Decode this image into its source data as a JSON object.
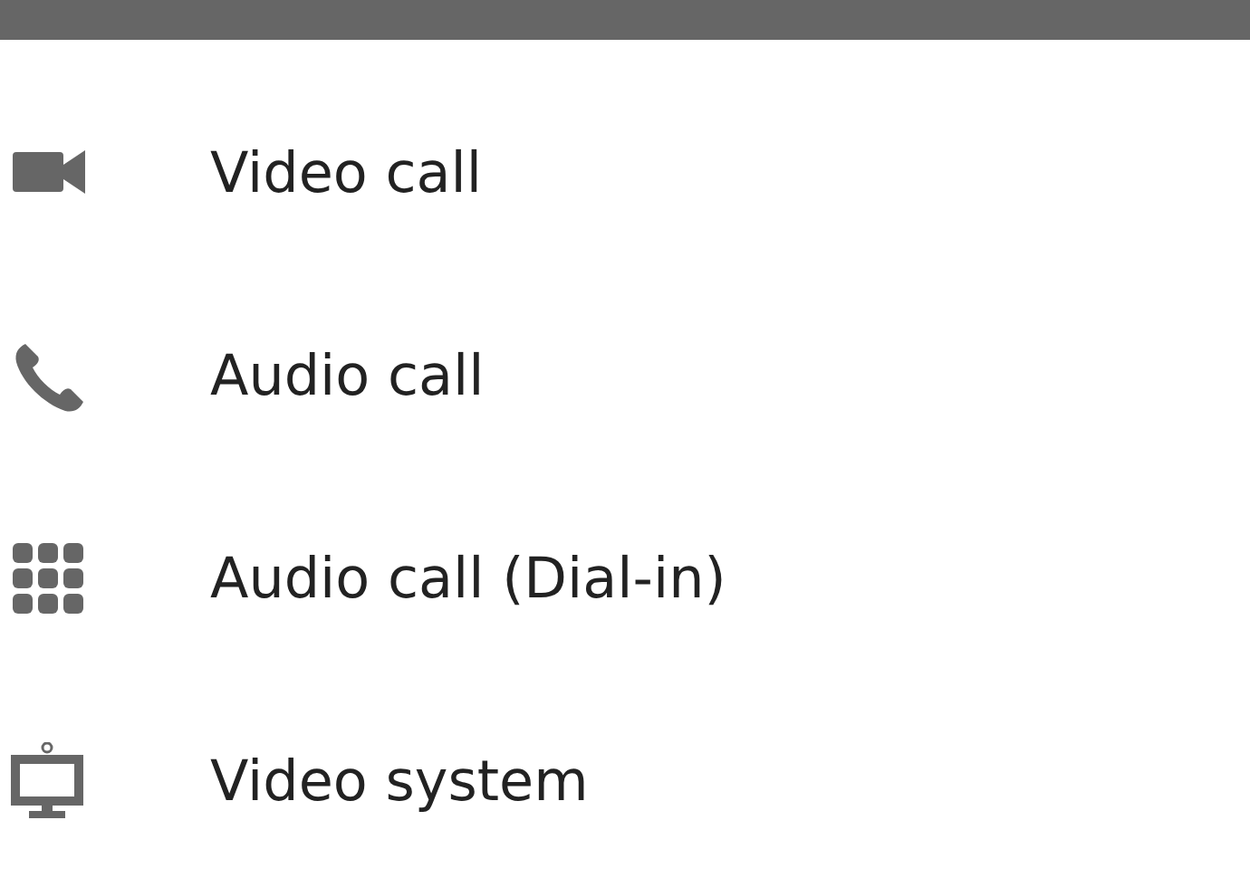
{
  "options": [
    {
      "kind": "video",
      "label": "Video call"
    },
    {
      "kind": "phone",
      "label": "Audio call"
    },
    {
      "kind": "dialpad",
      "label": "Audio call (Dial-in)"
    },
    {
      "kind": "system",
      "label": "Video system"
    }
  ]
}
